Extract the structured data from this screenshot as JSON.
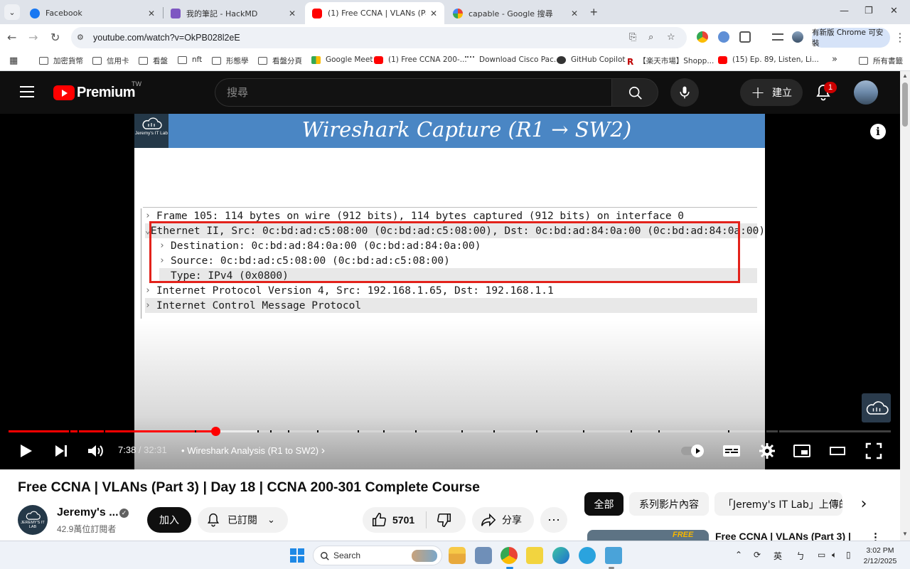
{
  "browser": {
    "tabs": [
      {
        "title": "Facebook",
        "favicon_color": "#1877f2",
        "close": "✕"
      },
      {
        "title": "我的筆記 - HackMD",
        "favicon_color": "#7e57c2",
        "close": "✕"
      },
      {
        "title": "(1) Free CCNA | VLANs (Part 3) |",
        "favicon_color": "#ff0000",
        "close": "✕",
        "active": true
      },
      {
        "title": "capable - Google 搜尋",
        "favicon_color": "#4285f4",
        "close": "✕"
      }
    ],
    "url": "youtube.com/watch?v=OkPB028l2eE",
    "update_button": "有新版 Chrome 可安裝",
    "bookmarks": [
      {
        "label": "加密貨幣",
        "icon": "folder-icon"
      },
      {
        "label": "信用卡",
        "icon": "folder-icon"
      },
      {
        "label": "看盤",
        "icon": "folder-icon"
      },
      {
        "label": "nft",
        "icon": "folder-icon"
      },
      {
        "label": "形態學",
        "icon": "folder-icon"
      },
      {
        "label": "看盤分頁",
        "icon": "folder-icon"
      },
      {
        "label": "Google Meet",
        "icon": "google-meet-icon"
      },
      {
        "label": "(1) Free CCNA 200-...",
        "icon": "youtube-icon"
      },
      {
        "label": "Download Cisco Pac...",
        "icon": "netacad-icon"
      },
      {
        "label": "GitHub Copilot",
        "icon": "github-copilot-icon"
      },
      {
        "label": "【楽天市場】Shopp...",
        "icon": "rakuten-icon"
      },
      {
        "label": "(15) Ep. 89, Listen, Li...",
        "icon": "youtube-icon"
      }
    ],
    "all_bookmarks": "所有書籤",
    "bookmarks_overflow": "»"
  },
  "youtube": {
    "brand": "Premium",
    "region": "TW",
    "search_placeholder": "搜尋",
    "create_label": "建立",
    "notification_count": "1",
    "video": {
      "slide_logo_text": "Jeremy's IT Lab",
      "slide_title": "Wireshark Capture (R1 → SW2)",
      "wireshark_rows": [
        {
          "arrow": "›",
          "text": "Frame 105: 114 bytes on wire (912 bits), 114 bytes captured (912 bits) on interface 0"
        },
        {
          "arrow": "⌄",
          "text": "Ethernet II, Src: 0c:bd:ad:c5:08:00 (0c:bd:ad:c5:08:00), Dst: 0c:bd:ad:84:0a:00 (0c:bd:ad:84:0a:00)"
        },
        {
          "arrow": "›",
          "text": "Destination: 0c:bd:ad:84:0a:00 (0c:bd:ad:84:0a:00)"
        },
        {
          "arrow": "›",
          "text": "Source: 0c:bd:ad:c5:08:00 (0c:bd:ad:c5:08:00)"
        },
        {
          "arrow": "",
          "text": "Type: IPv4 (0x0800)"
        },
        {
          "arrow": "›",
          "text": "Internet Protocol Version 4, Src: 192.168.1.65, Dst: 192.168.1.1"
        },
        {
          "arrow": "›",
          "text": "Internet Control Message Protocol"
        }
      ],
      "current_time": "7:38",
      "separator": " / ",
      "duration": "32:31",
      "progress_fraction": 0.235,
      "buffered_fraction": 0.282,
      "chapter_prefix": "•",
      "chapter": "Wireshark Analysis (R1 to SW2)",
      "chapter_arrow": "›"
    },
    "title": "Free CCNA | VLANs (Part 3) | Day 18 | CCNA 200-301 Complete Course",
    "channel": {
      "name": "Jeremy's ...",
      "subscribers": "42.9萬位訂閱者",
      "avatar_text": "JEREMY'S IT LAB"
    },
    "join_label": "加入",
    "subscribed_label": "已訂閱",
    "likes": "5701",
    "share_label": "分享",
    "more_label": "⋯",
    "filters": [
      "全部",
      "系列影片內容",
      "「Jeremy's IT Lab」上傳的"
    ],
    "filters_next": "›",
    "recommended_title": "Free CCNA | VLANs (Part 3) |",
    "recommended_thumb_badge": "FREE",
    "recommended_more": "⋮"
  },
  "taskbar": {
    "search_label": "Search",
    "ime": "英",
    "ime2": "ㄅ",
    "time": "3:02 PM",
    "date": "2/12/2025"
  },
  "colors": {
    "yt_red": "#ff0000",
    "yt_dark": "#0f0f0f",
    "slide_header": "#4a86c4",
    "highlight_box": "#e3221b"
  }
}
